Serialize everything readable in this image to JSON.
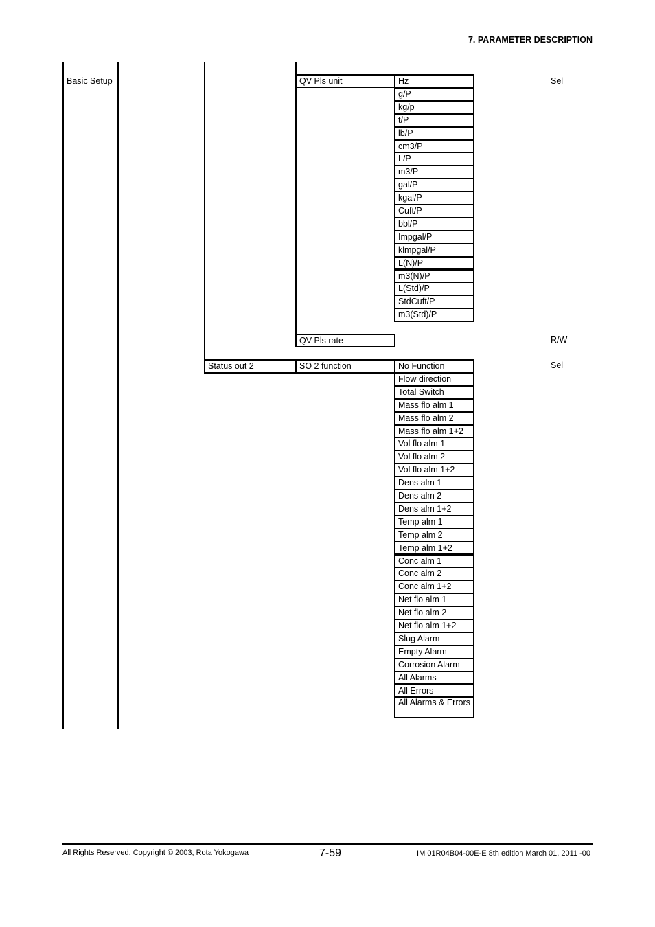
{
  "header": {
    "section_title": "7.  PARAMETER DESCRIPTION"
  },
  "menu": {
    "level1": "Basic Setup",
    "qv_pls_unit": {
      "label": "QV Pls unit",
      "access": "Sel",
      "options": [
        "Hz",
        "g/P",
        "kg/p",
        "t/P",
        "lb/P",
        "cm3/P",
        "L/P",
        "m3/P",
        "gal/P",
        "kgal/P",
        "Cuft/P",
        "bbl/P",
        "Impgal/P",
        "klmpgal/P",
        "L(N)/P",
        "m3(N)/P",
        "L(Std)/P",
        "StdCuft/P",
        "m3(Std)/P"
      ]
    },
    "qv_pls_rate": {
      "label": "QV Pls rate",
      "access": "R/W"
    },
    "status_out_2": {
      "label": "Status out 2",
      "so2_function": {
        "label": "SO 2 function",
        "access": "Sel",
        "options": [
          "No Function",
          "Flow direction",
          "Total Switch",
          "Mass flo alm 1",
          "Mass flo alm 2",
          "Mass flo alm 1+2",
          "Vol flo alm 1",
          "Vol flo alm 2",
          "Vol flo alm 1+2",
          "Dens alm 1",
          "Dens alm 2",
          "Dens alm 1+2",
          "Temp alm 1",
          "Temp alm 2",
          "Temp alm 1+2",
          "Conc alm 1",
          "Conc alm 2",
          "Conc alm 1+2",
          "Net flo alm 1",
          "Net flo alm 2",
          "Net flo alm 1+2",
          "Slug Alarm",
          "Empty Alarm",
          "Corrosion Alarm",
          "All Alarms",
          "All Errors",
          "All Alarms & Errors"
        ]
      }
    }
  },
  "footer": {
    "copyright": "All Rights Reserved. Copyright © 2003, Rota Yokogawa",
    "page_number": "7-59",
    "doc_id": "IM 01R04B04-00E-E  8th edition March 01, 2011 -00"
  }
}
